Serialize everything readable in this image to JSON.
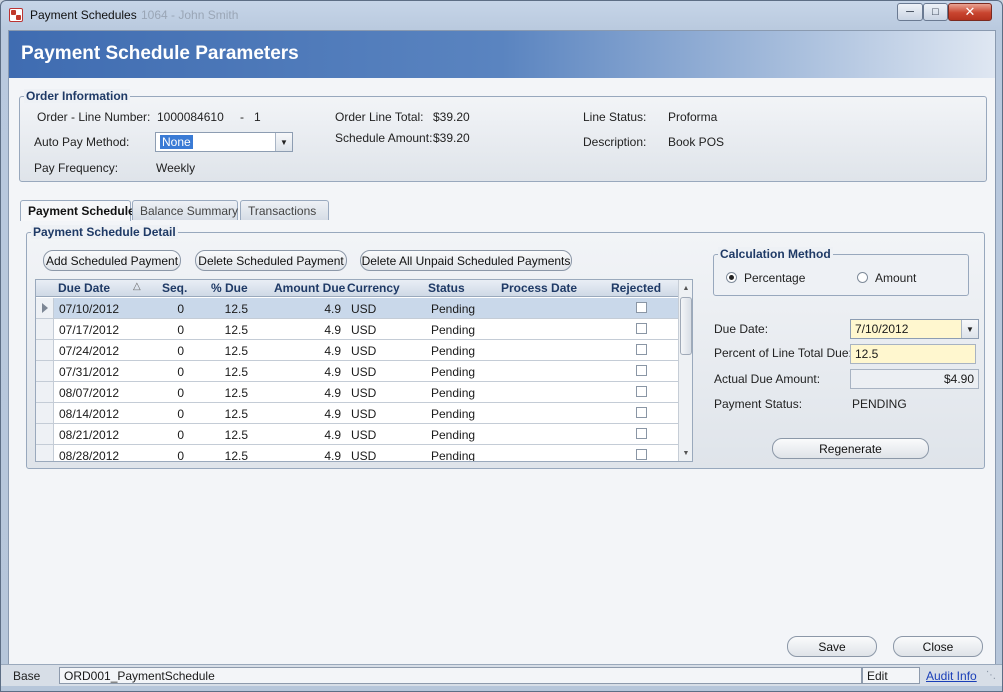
{
  "window": {
    "title": "Payment Schedules",
    "ghost_title": "1064 - John Smith"
  },
  "banner": {
    "title": "Payment Schedule Parameters"
  },
  "order_info": {
    "group_title": "Order Information",
    "order_line_label": "Order - Line Number:",
    "order_number": "1000084610",
    "dash": "-",
    "line_number": "1",
    "auto_pay_label": "Auto Pay Method:",
    "auto_pay_value": "None",
    "pay_freq_label": "Pay Frequency:",
    "pay_freq_value": "Weekly",
    "order_total_label": "Order Line Total:",
    "order_total_value": "$39.20",
    "schedule_amount_label": "Schedule Amount:",
    "schedule_amount_value": "$39.20",
    "line_status_label": "Line Status:",
    "line_status_value": "Proforma",
    "description_label": "Description:",
    "description_value": "Book POS"
  },
  "tabs": [
    {
      "label": "Payment Schedule",
      "active": true
    },
    {
      "label": "Balance Summary",
      "active": false
    },
    {
      "label": "Transactions",
      "active": false
    }
  ],
  "detail": {
    "group_title": "Payment Schedule Detail",
    "buttons": {
      "add": "Add Scheduled Payment",
      "delete": "Delete Scheduled Payment",
      "delete_all": "Delete All Unpaid Scheduled Payments"
    },
    "columns": {
      "due_date": "Due Date",
      "sort_icon": "△",
      "seq": "Seq.",
      "pct_due": "% Due",
      "amount_due": "Amount Due",
      "currency": "Currency",
      "status": "Status",
      "process_date": "Process Date",
      "rejected": "Rejected"
    },
    "rows": [
      {
        "due_date": "07/10/2012",
        "seq": "0",
        "pct": "12.5",
        "amount": "4.9",
        "currency": "USD",
        "status": "Pending",
        "process_date": ""
      },
      {
        "due_date": "07/17/2012",
        "seq": "0",
        "pct": "12.5",
        "amount": "4.9",
        "currency": "USD",
        "status": "Pending",
        "process_date": ""
      },
      {
        "due_date": "07/24/2012",
        "seq": "0",
        "pct": "12.5",
        "amount": "4.9",
        "currency": "USD",
        "status": "Pending",
        "process_date": ""
      },
      {
        "due_date": "07/31/2012",
        "seq": "0",
        "pct": "12.5",
        "amount": "4.9",
        "currency": "USD",
        "status": "Pending",
        "process_date": ""
      },
      {
        "due_date": "08/07/2012",
        "seq": "0",
        "pct": "12.5",
        "amount": "4.9",
        "currency": "USD",
        "status": "Pending",
        "process_date": ""
      },
      {
        "due_date": "08/14/2012",
        "seq": "0",
        "pct": "12.5",
        "amount": "4.9",
        "currency": "USD",
        "status": "Pending",
        "process_date": ""
      },
      {
        "due_date": "08/21/2012",
        "seq": "0",
        "pct": "12.5",
        "amount": "4.9",
        "currency": "USD",
        "status": "Pending",
        "process_date": ""
      },
      {
        "due_date": "08/28/2012",
        "seq": "0",
        "pct": "12.5",
        "amount": "4.9",
        "currency": "USD",
        "status": "Pending",
        "process_date": ""
      }
    ]
  },
  "calc": {
    "group_title": "Calculation Method",
    "percentage_label": "Percentage",
    "amount_label": "Amount",
    "due_date_label": "Due Date:",
    "due_date_value": "7/10/2012",
    "percent_label": "Percent of Line Total Due:",
    "percent_value": "12.5",
    "actual_label": "Actual Due Amount:",
    "actual_value": "$4.90",
    "payment_status_label": "Payment Status:",
    "payment_status_value": "PENDING",
    "regenerate": "Regenerate"
  },
  "footer": {
    "save": "Save",
    "close": "Close"
  },
  "statusbar": {
    "base": "Base",
    "form_id": "ORD001_PaymentSchedule",
    "mode": "Edit",
    "audit": "Audit Info"
  },
  "colors": {
    "banner_start": "#3f6cb1",
    "header_text": "#1f3a66",
    "highlight_field": "#fff7cf",
    "selected_row": "#c9d8ea"
  }
}
